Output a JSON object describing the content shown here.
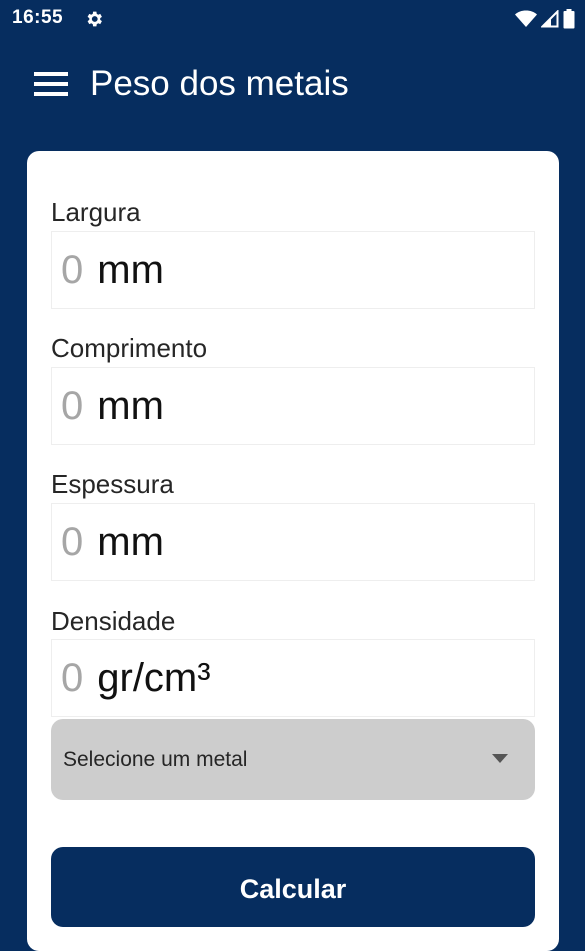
{
  "status_bar": {
    "time": "16:55",
    "icons": [
      "settings-gear-icon",
      "wifi-icon",
      "cellular-signal-icon",
      "battery-icon"
    ]
  },
  "app_bar": {
    "menu_icon": "hamburger-menu-icon",
    "title": "Peso dos metais"
  },
  "form": {
    "fields": [
      {
        "label": "Largura",
        "placeholder": "0",
        "unit": "mm"
      },
      {
        "label": "Comprimento",
        "placeholder": "0",
        "unit": "mm"
      },
      {
        "label": "Espessura",
        "placeholder": "0",
        "unit": "mm"
      },
      {
        "label": "Densidade",
        "placeholder": "0",
        "unit": "gr/cm³"
      }
    ],
    "metal_select": {
      "value": "Selecione um metal",
      "icon": "dropdown-arrow-icon"
    },
    "calculate_label": "Calcular"
  },
  "colors": {
    "primary": "#062d5f",
    "card_background": "#ffffff",
    "select_background": "#cdcdcd",
    "placeholder_text": "#a6a6a6"
  }
}
